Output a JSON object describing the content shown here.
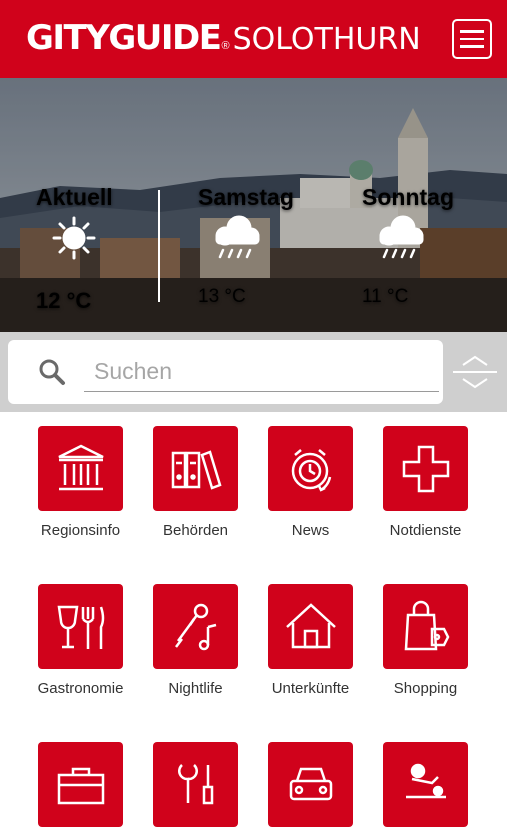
{
  "header": {
    "logo_main": "GITYGUIDE",
    "logo_reg": "®",
    "logo_city": "SOLOTHURN",
    "menu_icon": "hamburger-menu-icon"
  },
  "weather": [
    {
      "day": "Aktuell",
      "temp": "12 °C",
      "icon": "sun-icon"
    },
    {
      "day": "Samstag",
      "temp": "13 °C",
      "icon": "rain-cloud-icon"
    },
    {
      "day": "Sonntag",
      "temp": "11 °C",
      "icon": "rain-cloud-icon"
    }
  ],
  "search": {
    "placeholder": "Suchen",
    "value": "",
    "icon": "search-icon",
    "toggle_icon": "expand-collapse-icon"
  },
  "categories": [
    {
      "label": "Regionsinfo",
      "icon": "building-columns-icon"
    },
    {
      "label": "Behörden",
      "icon": "binders-icon"
    },
    {
      "label": "News",
      "icon": "alarm-clock-icon"
    },
    {
      "label": "Notdienste",
      "icon": "cross-icon"
    },
    {
      "label": "Gastronomie",
      "icon": "wine-cutlery-icon"
    },
    {
      "label": "Nightlife",
      "icon": "microphone-music-icon"
    },
    {
      "label": "Unterkünfte",
      "icon": "house-icon"
    },
    {
      "label": "Shopping",
      "icon": "shopping-bag-icon"
    },
    {
      "label": "",
      "icon": "briefcase-icon"
    },
    {
      "label": "",
      "icon": "tools-icon"
    },
    {
      "label": "",
      "icon": "car-icon"
    },
    {
      "label": "",
      "icon": "massage-icon"
    }
  ]
}
